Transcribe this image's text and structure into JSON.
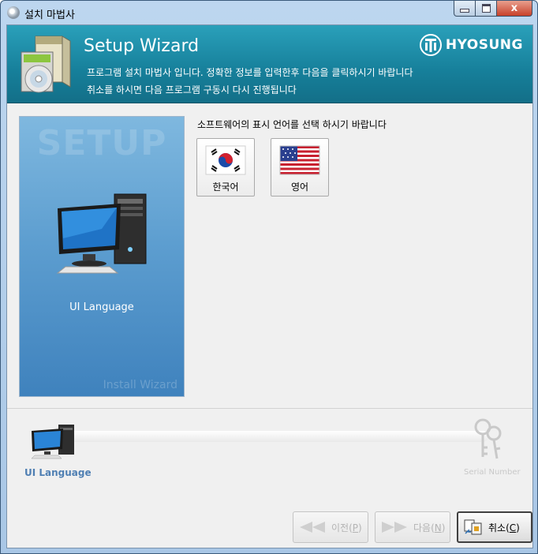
{
  "window": {
    "title": "설치 마법사",
    "close_glyph": "x"
  },
  "banner": {
    "title": "Setup Wizard",
    "line1": "프로그램 설치 마법사 입니다. 정확한 정보를 입력한후 다음을 클릭하시기 바랍니다",
    "line2": "취소를 하시면 다음 프로그램 구동시 다시 진행됩니다",
    "brand": "HYOSUNG"
  },
  "side_panel": {
    "watermark": "SETUP",
    "label": "UI Language",
    "footer": "Install Wizard"
  },
  "main": {
    "prompt": "소프트웨어의 표시 언어를 선택 하시기 바랍니다",
    "languages": [
      {
        "label": "한국어",
        "flag": "korea-flag-icon"
      },
      {
        "label": "영어",
        "flag": "usa-flag-icon"
      }
    ]
  },
  "progress": {
    "steps": [
      {
        "label": "UI Language",
        "active": true
      },
      {
        "label": "Serial Number",
        "active": false
      }
    ]
  },
  "buttons": {
    "prev": {
      "label": "이전(",
      "key": "P",
      "suffix": ")",
      "enabled": false
    },
    "next": {
      "label": "다음(",
      "key": "N",
      "suffix": ")",
      "enabled": false
    },
    "cancel": {
      "label": "취소(",
      "key": "C",
      "suffix": ")",
      "enabled": true
    }
  },
  "colors": {
    "banner": "#167f9a",
    "panel": "#5d9ed0",
    "active_step": "#4f7fb3"
  }
}
